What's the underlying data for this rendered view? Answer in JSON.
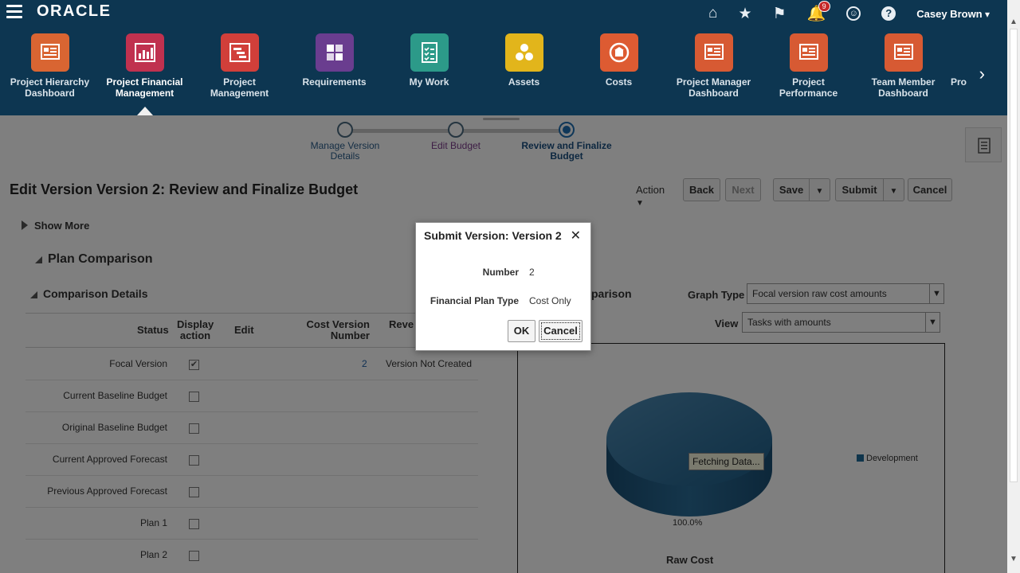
{
  "header": {
    "logo": "ORACLE",
    "notification_count": "9",
    "user_name": "Casey Brown"
  },
  "springboard": [
    {
      "label_1": "Project Hierarchy",
      "label_2": "Dashboard",
      "color": "#d96532"
    },
    {
      "label_1": "Project Financial",
      "label_2": "Management",
      "color": "#c0314f"
    },
    {
      "label_1": "Project",
      "label_2": "Management",
      "color": "#d13f3a"
    },
    {
      "label_1": "Requirements",
      "label_2": "",
      "color": "#6a3d8f"
    },
    {
      "label_1": "My Work",
      "label_2": "",
      "color": "#2c9a89"
    },
    {
      "label_1": "Assets",
      "label_2": "",
      "color": "#e2b51b"
    },
    {
      "label_1": "Costs",
      "label_2": "",
      "color": "#dd5b32"
    },
    {
      "label_1": "Project Manager",
      "label_2": "Dashboard",
      "color": "#d75a33"
    },
    {
      "label_1": "Project",
      "label_2": "Performance",
      "color": "#d75a33"
    },
    {
      "label_1": "Team Member",
      "label_2": "Dashboard",
      "color": "#d75a33"
    },
    {
      "label_1": "Pro",
      "label_2": "",
      "color": "#d75a33"
    }
  ],
  "train": {
    "steps": [
      {
        "label_1": "Manage Version",
        "label_2": "Details"
      },
      {
        "label_1": "Edit Budget",
        "label_2": ""
      },
      {
        "label_1": "Review and Finalize",
        "label_2": "Budget"
      }
    ]
  },
  "page": {
    "title": "Edit Version Version 2: Review and Finalize Budget",
    "show_more": "Show More",
    "plan_comparison": "Plan Comparison",
    "comparison_details": "Comparison Details"
  },
  "toolbar": {
    "action": "Action",
    "back": "Back",
    "next": "Next",
    "save": "Save",
    "submit": "Submit",
    "cancel": "Cancel"
  },
  "table": {
    "headers": {
      "status": "Status",
      "display_1": "Display",
      "display_2": "action",
      "edit": "Edit",
      "cost_1": "Cost Version",
      "cost_2": "Number",
      "revenue": "Reve"
    },
    "rows": [
      {
        "status": "Focal Version",
        "checked": "✔",
        "number": "2",
        "revenue": "Version Not Created"
      },
      {
        "status": "Current Baseline Budget",
        "checked": "",
        "number": "",
        "revenue": ""
      },
      {
        "status": "Original Baseline Budget",
        "checked": "",
        "number": "",
        "revenue": ""
      },
      {
        "status": "Current Approved Forecast",
        "checked": "",
        "number": "",
        "revenue": ""
      },
      {
        "status": "Previous Approved Forecast",
        "checked": "",
        "number": "",
        "revenue": ""
      },
      {
        "status": "Plan 1",
        "checked": "",
        "number": "",
        "revenue": ""
      },
      {
        "status": "Plan 2",
        "checked": "",
        "number": "",
        "revenue": ""
      }
    ]
  },
  "graph": {
    "title": "omparison",
    "graph_type_label": "Graph Type",
    "graph_type_value": "Focal version raw cost amounts",
    "view_label": "View",
    "view_value": "Tasks with amounts",
    "fetching": "Fetching Data...",
    "legend": "Development",
    "percent": "100.0%",
    "footer": "Raw Cost"
  },
  "dialog": {
    "title": "Submit Version: Version 2",
    "number_label": "Number",
    "number_value": "2",
    "plan_type_label": "Financial Plan Type",
    "plan_type_value": "Cost Only",
    "ok": "OK",
    "cancel": "Cancel"
  }
}
